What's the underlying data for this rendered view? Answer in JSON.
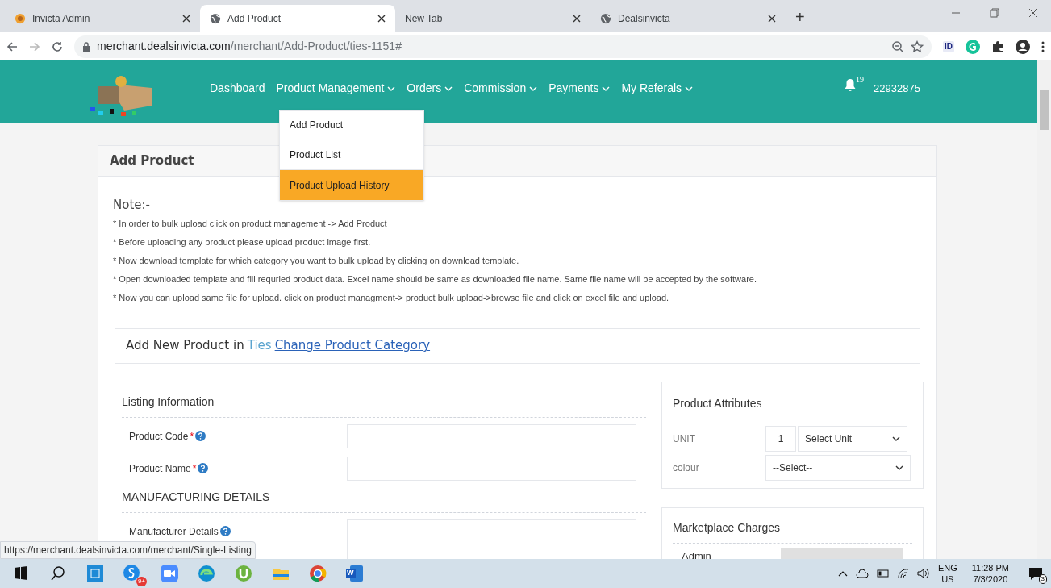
{
  "browser": {
    "tabs": [
      {
        "title": "Invicta Admin",
        "selected": false
      },
      {
        "title": "Add Product",
        "selected": true
      },
      {
        "title": "New Tab",
        "selected": false
      },
      {
        "title": "Dealsinvicta",
        "selected": false
      }
    ],
    "new_tab": "+",
    "extension_label": "iD",
    "url_host": "merchant.dealsinvicta.com",
    "url_path": "/merchant/Add-Product/ties-1151#"
  },
  "nav": {
    "items": [
      {
        "label": "Dashboard",
        "has_menu": false
      },
      {
        "label": "Product Management",
        "has_menu": true
      },
      {
        "label": "Orders",
        "has_menu": true
      },
      {
        "label": "Commission",
        "has_menu": true
      },
      {
        "label": "Payments",
        "has_menu": true
      },
      {
        "label": "My Referals",
        "has_menu": true
      }
    ],
    "notification_count": "19",
    "account": "22932875"
  },
  "dropdown": [
    {
      "label": "Add Product",
      "selected": false
    },
    {
      "label": "Product List",
      "selected": false
    },
    {
      "label": "Product Upload History",
      "selected": true
    }
  ],
  "card": {
    "title": "Add Product",
    "note_heading": "Note:-",
    "notes": [
      "* In order to bulk upload click on product management -> Add Product",
      "* Before uploading any product please upload product image first.",
      "* Now download template for which category you want to bulk upload by clicking on download template.",
      "* Open downloaded template and fill requried product data. Excel name should be same as downloaded file name. Same file name will be accepted by the software.",
      "* Now you can upload same file for upload. click on product managment-> product bulk upload->browse file and click on excel file and upload."
    ],
    "category_prefix": "Add New Product in",
    "category": "Ties",
    "change_link": "Change Product Category"
  },
  "listing": {
    "title": "Listing Information",
    "fields": [
      {
        "label": "Product Code",
        "required_mark": "*"
      },
      {
        "label": "Product Name",
        "required_mark": "*"
      }
    ],
    "section": "MANUFACTURING DETAILS",
    "section_fields": [
      {
        "label": "Manufacturer Details"
      }
    ]
  },
  "attributes": {
    "title": "Product Attributes",
    "rows": [
      {
        "kind": "qty_select",
        "label": "UNIT",
        "qty": "1",
        "select": "Select Unit"
      },
      {
        "kind": "select",
        "label": "colour",
        "select": "--Select--"
      }
    ]
  },
  "marketplace": {
    "title": "Marketplace Charges",
    "rows": [
      {
        "label": "Admin"
      }
    ]
  },
  "status_url": "https://merchant.dealsinvicta.com/merchant/Single-Listing",
  "taskbar": {
    "skype_badge": "9+",
    "word_letter": "W",
    "lang": "ENG",
    "region": "US",
    "time": "11:28 PM",
    "date": "7/3/2020",
    "notifications": "3"
  }
}
